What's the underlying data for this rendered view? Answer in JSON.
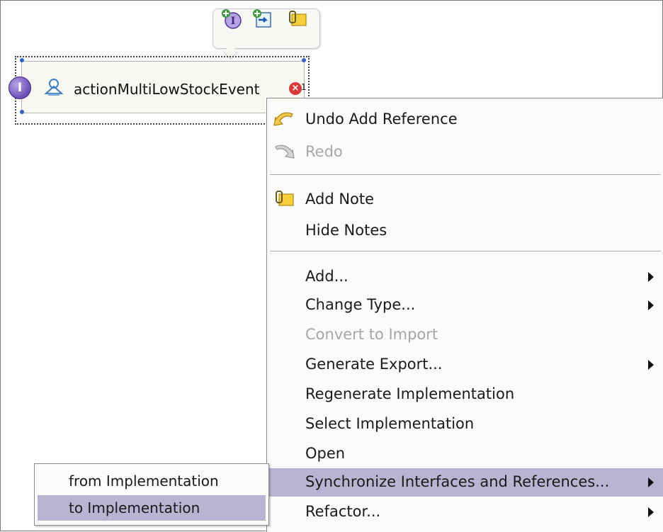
{
  "palette": {
    "icons": [
      "add-interface-icon",
      "add-reference-icon",
      "add-note-icon"
    ]
  },
  "component": {
    "name": "actionMultiLowStockEvent",
    "error_count": "1",
    "icons": [
      "interface-icon",
      "component-icon",
      "error-icon"
    ]
  },
  "menu": {
    "undo_label": "Undo Add Reference",
    "redo_label": "Redo",
    "add_note_label": "Add Note",
    "hide_notes_label": "Hide Notes",
    "add_label": "Add...",
    "change_type_label": "Change Type...",
    "convert_to_import_label": "Convert to Import",
    "generate_export_label": "Generate Export...",
    "regenerate_impl_label": "Regenerate Implementation",
    "select_impl_label": "Select Implementation",
    "open_label": "Open",
    "synchronize_label": "Synchronize Interfaces and References...",
    "refactor_label": "Refactor..."
  },
  "submenu": {
    "from_impl_label": "from Implementation",
    "to_impl_label": "to Implementation"
  },
  "colors": {
    "highlight": "#b8b4d2",
    "disabled_text": "#a7a7a7",
    "selection_handle": "#2f61c9"
  }
}
